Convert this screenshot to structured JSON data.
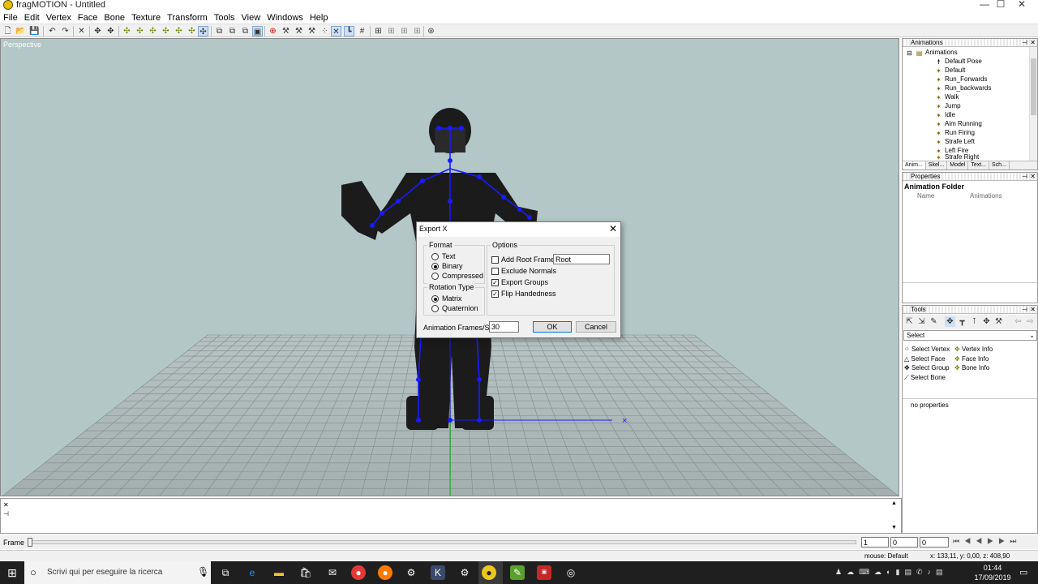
{
  "window": {
    "title": "fragMOTION - Untitled"
  },
  "menu": [
    "File",
    "Edit",
    "Vertex",
    "Face",
    "Bone",
    "Texture",
    "Transform",
    "Tools",
    "View",
    "Windows",
    "Help"
  ],
  "viewport": {
    "label": "Perspective",
    "axis_label": "×"
  },
  "dialog": {
    "title": "Export X",
    "format_label": "Format",
    "format_options": [
      "Text",
      "Binary",
      "Compressed"
    ],
    "format_selected": 1,
    "rotation_label": "Rotation Type",
    "rotation_options": [
      "Matrix",
      "Quaternion"
    ],
    "rotation_selected": 0,
    "options_label": "Options",
    "options": [
      {
        "label": "Add Root Frame",
        "checked": false
      },
      {
        "label": "Exclude Normals",
        "checked": false
      },
      {
        "label": "Export Groups",
        "checked": true
      },
      {
        "label": "Flip Handedness",
        "checked": true
      }
    ],
    "root_frame_value": "Root",
    "fps_label": "Animation Frames/Sec.",
    "fps_value": "30",
    "ok_label": "OK",
    "cancel_label": "Cancel"
  },
  "animations_panel": {
    "title": "Animations",
    "root": "Animations",
    "items": [
      "Default Pose",
      "Default",
      "Run_Forwards",
      "Run_backwards",
      "Walk",
      "Jump",
      "Idle",
      "Aim Running",
      "Run Firing",
      "Strafe Left",
      "Left Fire",
      "Strafe Right"
    ],
    "tabs": [
      "Anim...",
      "Skel...",
      "Model",
      "Text...",
      "Sch..."
    ]
  },
  "properties_panel": {
    "title": "Properties",
    "heading": "Animation Folder",
    "name_label": "Name",
    "name_value": "Animations"
  },
  "tools_panel": {
    "title": "Tools",
    "select_value": "Select",
    "items_left": [
      "Select Vertex",
      "Select Face",
      "Select Group",
      "Select Bone"
    ],
    "items_right": [
      "Vertex Info",
      "Face Info",
      "Bone Info"
    ],
    "no_properties": "no properties"
  },
  "frame": {
    "label": "Frame",
    "field1": "1",
    "field2": "0",
    "field3": "0"
  },
  "status": {
    "mouse": "mouse: Default",
    "coords": "x: 133,11, y: 0,00, z: 408,90"
  },
  "taskbar": {
    "search_placeholder": "Scrivi qui per eseguire la ricerca",
    "time": "01:44",
    "date": "17/09/2019"
  },
  "colors": {
    "viewport_bg": "#b3c7c7",
    "bone": "#1a1aff",
    "grid": "#7f8b8b",
    "taskbar": "#1f1f1f"
  }
}
